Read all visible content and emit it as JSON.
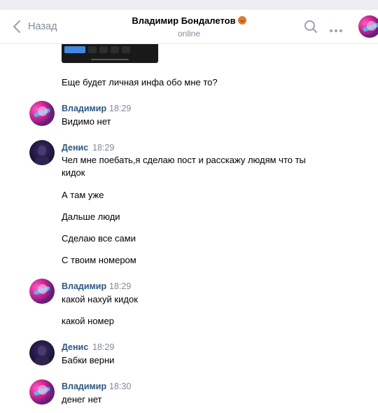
{
  "header": {
    "back_label": "Назад",
    "title": "Владимир Бондалетов",
    "status": "online",
    "icons": [
      "chevron-left-icon",
      "search-icon",
      "more-icon"
    ]
  },
  "messages": [
    {
      "text": "Еще будет личная инфа обо мне то?"
    },
    {
      "author": "Владимир",
      "time": "18:29",
      "texts": [
        "Видимо нет"
      ]
    },
    {
      "author": "Денис",
      "time": "18:29",
      "texts": [
        "Чел мне поебать,я сделаю пост и расскажу людям что ты кидок",
        "А там уже",
        "Дальше люди",
        "Сделаю все сами",
        "С твоим номером"
      ]
    },
    {
      "author": "Владимир",
      "time": "18:29",
      "texts": [
        "какой нахуй кидок",
        "какой номер"
      ]
    },
    {
      "author": "Денис",
      "time": "18:29",
      "texts": [
        "Бабки верни"
      ]
    },
    {
      "author": "Владимир",
      "time": "18:30",
      "texts": [
        "денег нет"
      ]
    }
  ],
  "colors": {
    "link": "#2a5885",
    "muted": "#818c99",
    "background": "#ebedf0"
  }
}
